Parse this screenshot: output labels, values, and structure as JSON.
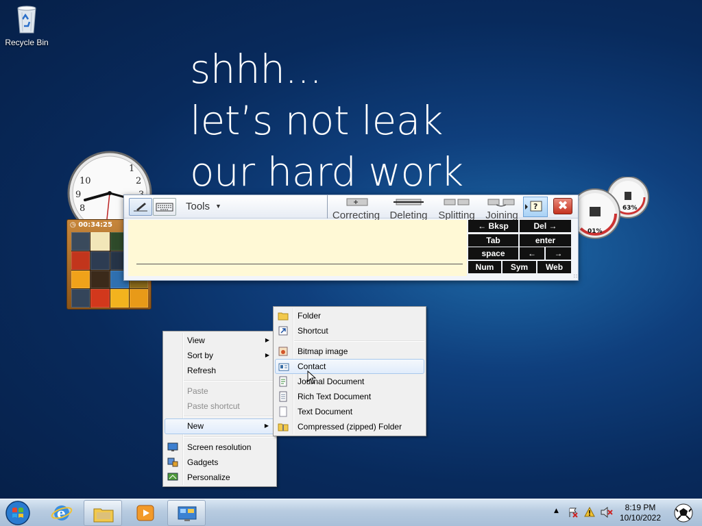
{
  "desktop": {
    "recycle_bin_label": "Recycle Bin",
    "wallpaper_lines": [
      "shhh...",
      "let’s not leak",
      "our hard work"
    ]
  },
  "gadgets": {
    "clock": {
      "icon": "analog-clock-icon",
      "numbers": [
        "10",
        "9",
        "8",
        "1",
        "2",
        "3"
      ]
    },
    "puzzle": {
      "timer": "00:34:25"
    },
    "meters": {
      "cpu": "01%",
      "memory": "63%"
    }
  },
  "input_panel": {
    "tools_label": "Tools",
    "gestures": [
      "Correcting",
      "Deleting",
      "Splitting",
      "Joining"
    ],
    "keys": {
      "bksp": "← Bksp",
      "del": "Del →",
      "tab": "Tab",
      "enter": "enter",
      "space": "space",
      "left": "←",
      "right": "→",
      "num": "Num",
      "sym": "Sym",
      "web": "Web"
    },
    "close_glyph": "✖",
    "help_glyph": "?"
  },
  "context_menu": {
    "view": "View",
    "sort_by": "Sort by",
    "refresh": "Refresh",
    "paste": "Paste",
    "paste_shortcut": "Paste shortcut",
    "new": "New",
    "screen_resolution": "Screen resolution",
    "gadgets": "Gadgets",
    "personalize": "Personalize"
  },
  "new_submenu": {
    "folder": "Folder",
    "shortcut": "Shortcut",
    "bitmap": "Bitmap image",
    "contact": "Contact",
    "journal": "Journal Document",
    "rtf": "Rich Text Document",
    "text": "Text Document",
    "zip": "Compressed (zipped) Folder"
  },
  "taskbar": {
    "time": "8:19 PM",
    "date": "10/10/2022",
    "pinned": [
      "internet-explorer-icon",
      "windows-explorer-icon",
      "media-player-icon",
      "control-panel-icon"
    ]
  },
  "colors": {
    "desktop_bg": "#0a2f66",
    "menu_highlight": "#e1ecfb",
    "writing_area": "#fff9d6",
    "close_red": "#c5321f"
  }
}
